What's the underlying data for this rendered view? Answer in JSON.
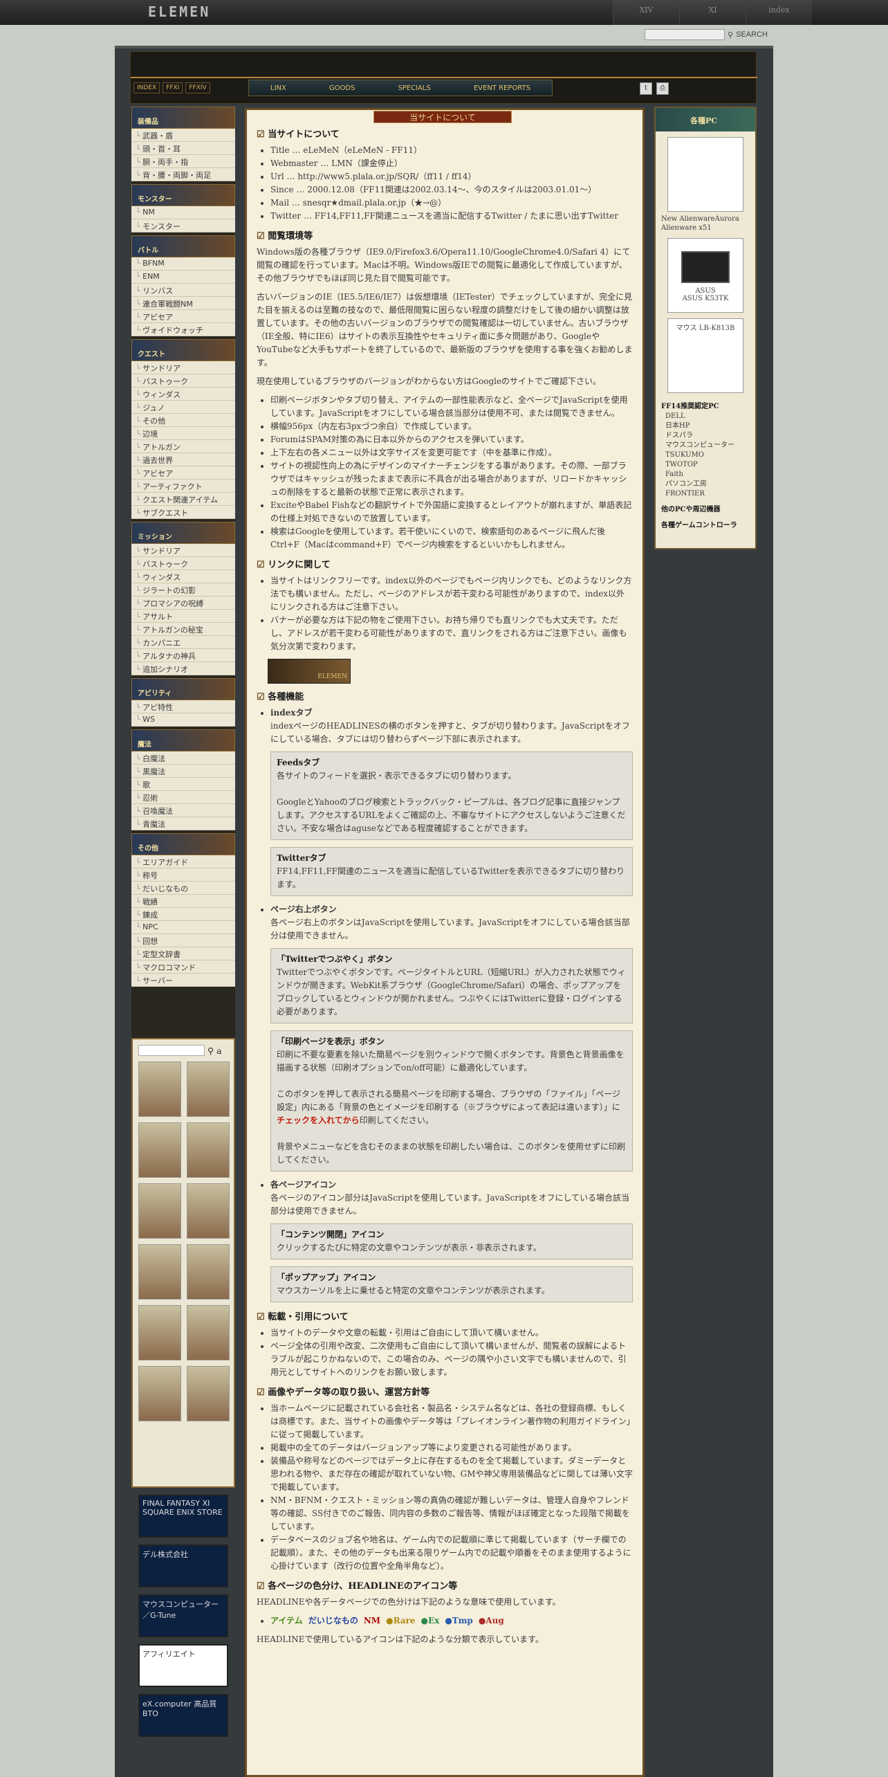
{
  "top": {
    "logo": "ELEMEN",
    "nav": [
      "XIV",
      "XI",
      "index"
    ],
    "search_label": "SEARCH"
  },
  "header": {
    "tabs": [
      "INDEX",
      "FFXI",
      "FFXIV"
    ],
    "nav": [
      "LINX",
      "GOODS",
      "SPECIALS",
      "EVENT REPORTS"
    ]
  },
  "main_title": "当サイトについて",
  "sidebar": [
    {
      "title": "装備品",
      "items": [
        "武器・盾",
        "頭・首・耳",
        "胴・両手・指",
        "背・腰・両脚・両足"
      ]
    },
    {
      "title": "モンスター",
      "items": [
        "NM",
        "モンスター"
      ]
    },
    {
      "title": "バトル",
      "items": [
        "BFNM",
        "ENM",
        "リンバス",
        "連合軍戦闘NM",
        "アビセア",
        "ヴォイドウォッチ"
      ]
    },
    {
      "title": "クエスト",
      "items": [
        "サンドリア",
        "バストゥーク",
        "ウィンダス",
        "ジュノ",
        "その他",
        "辺境",
        "アトルガン",
        "過去世界",
        "アビセア",
        "アーティファクト",
        "クエスト関連アイテム",
        "サブクエスト"
      ]
    },
    {
      "title": "ミッション",
      "items": [
        "サンドリア",
        "バストゥーク",
        "ウィンダス",
        "ジラートの幻影",
        "プロマシアの呪縛",
        "アサルト",
        "アトルガンの秘宝",
        "カンパニエ",
        "アルタナの神兵",
        "追加シナリオ"
      ]
    },
    {
      "title": "アビリティ",
      "items": [
        "アビ特性",
        "WS"
      ]
    },
    {
      "title": "魔法",
      "items": [
        "白魔法",
        "黒魔法",
        "歌",
        "忍術",
        "召喚魔法",
        "青魔法"
      ]
    },
    {
      "title": "その他",
      "items": [
        "エリアガイド",
        "称号",
        "だいじなもの",
        "戦績",
        "錬成",
        "NPC",
        "回想",
        "定型文辞書",
        "マクロコマンド",
        "サーバー"
      ]
    }
  ],
  "banners": [
    "FINAL FANTASY XI SQUARE ENIX STORE",
    "デル株式会社",
    "マウスコンピューター／G-Tune",
    "アフィリエイト",
    "eX.computer 高品質BTO"
  ],
  "right": {
    "title": "各種PC",
    "pcs": [
      {
        "img": "",
        "cap": "New AlienwareAurora Alienware x51"
      },
      {
        "img": "ASUS",
        "cap": "ASUS K53TK"
      },
      {
        "img": "マウス LB-K813B",
        "cap": ""
      }
    ],
    "rec_title": "FF14推奨認定PC",
    "rec": [
      "DELL",
      "日本HP",
      "ドスパラ",
      "マウスコンピューター",
      "TSUKUMO",
      "TWOTOP",
      "Faith",
      "パソコン工房",
      "FRONTIER"
    ],
    "other": [
      "他のPCや周辺機器",
      "各種ゲームコントローラ"
    ]
  },
  "s1": {
    "h": "当サイトについて",
    "items": [
      "Title … eLeMeN（eLeMeN - FF11）",
      "Webmaster … LMN（課金停止）",
      "Url … http://www5.plala.or.jp/SQR/（ff11 / ff14）",
      "Since … 2000.12.08（FF11関連は2002.03.14～、今のスタイルは2003.01.01～）",
      "Mail … snesqr★dmail.plala.or.jp（★→@）",
      "Twitter … FF14,FF11,FF関連ニュースを適当に配信するTwitter / たまに思い出すTwitter"
    ]
  },
  "s2": {
    "h": "閲覧環境等",
    "p1": "Windows版の各種ブラウザ（IE9.0/Firefox3.6/Opera11.10/GoogleChrome4.0/Safari 4）にて閲覧の確認を行っています。Macは不明。Windows版IEでの閲覧に最適化して作成していますが、その他ブラウザでもほぼ同じ見た目で閲覧可能です。",
    "p2": "古いバージョンのIE（IE5.5/IE6/IE7）は仮想環境（IETester）でチェックしていますが、完全に見た目を揃えるのは至難の技なので、最低限閲覧に困らない程度の調整だけをして後の細かい調整は放置しています。その他の古いバージョンのブラウザでの閲覧確認は一切していません。古いブラウザ（IE全般、特にIE6）はサイトの表示互換性やセキュリティ面に多々問題があり、GoogleやYouTubeなど大手もサポートを終了しているので、最新版のブラウザを使用する事を強くお勧めします。",
    "p3": "現在使用しているブラウザのバージョンがわからない方はGoogleのサイトでご確認下さい。",
    "items": [
      "印刷ページボタンやタブ切り替え、アイテムの一部性能表示など、全ページでJavaScriptを使用しています。JavaScriptをオフにしている場合該当部分は使用不可、または閲覧できません。",
      "横幅956px（内左右3pxづつ余白）で作成しています。",
      "ForumはSPAM対策の為に日本以外からのアクセスを弾いています。",
      "上下左右の各メニュー以外は文字サイズを変更可能です（中を基準に作成）。",
      "サイトの視認性向上の為にデザインのマイナーチェンジをする事があります。その際、一部ブラウザではキャッシュが残ったままで表示に不具合が出る場合がありますが、リロードかキャッシュの削除をすると最新の状態で正常に表示されます。",
      "ExciteやBabel Fishなどの翻訳サイトで外国語に変換するとレイアウトが崩れますが、単語表記の仕様上対処できないので放置しています。",
      "検索はGoogleを使用しています。若干使いにくいので、検索語句のあるページに飛んだ後Ctrl+F（Macはcommand+F）でページ内検索をするといいかもしれません。"
    ]
  },
  "s3": {
    "h": "リンクに関して",
    "items": [
      "当サイトはリンクフリーです。index以外のページでもページ内リンクでも、どのようなリンク方法でも構いません。ただし、ページのアドレスが若干変わる可能性がありますので、index以外にリンクされる方はご注意下さい。",
      "バナーが必要な方は下記の物をご使用下さい。お持ち帰りでも直リンクでも大丈夫です。ただし、アドレスが若干変わる可能性がありますので、直リンクをされる方はご注意下さい。画像も気分次第で変わります。"
    ]
  },
  "s4": {
    "h": "各種機能",
    "index_tab": "indexタブ",
    "index_desc": "indexページのHEADLINESの横のボタンを押すと、タブが切り替わります。JavaScriptをオフにしている場合、タブには切り替わらずページ下部に表示されます。",
    "feeds_h": "Feedsタブ",
    "feeds_p": "各サイトのフィードを選択・表示できるタブに切り替わります。",
    "feeds_p2": "GoogleとYahooのブログ検索とトラックバック・ピープルは、各ブログ記事に直接ジャンプします。アクセスするURLをよくご確認の上、不審なサイトにアクセスしないようご注意ください。不安な場合はaguseなどである程度確認することができます。",
    "tw_h": "Twitterタブ",
    "tw_p": "FF14,FF11,FF関連のニュースを適当に配信しているTwitterを表示できるタブに切り替わります。",
    "topright": "ページ右上ボタン",
    "topright_p": "各ページ右上のボタンはJavaScriptを使用しています。JavaScriptをオフにしている場合該当部分は使用できません。",
    "tweet_h": "「Twitterでつぶやく」ボタン",
    "tweet_p": "Twitterでつぶやくボタンです。ページタイトルとURL（短縮URL）が入力された状態でウィンドウが開きます。WebKit系ブラウザ（GoogleChrome/Safari）の場合、ポップアップをブロックしているとウィンドウが開かれません。つぶやくにはTwitterに登録・ログインする必要があります。",
    "print_h": "「印刷ページを表示」ボタン",
    "print_p": "印刷に不要な要素を除いた簡易ページを別ウィンドウで開くボタンです。背景色と背景画像を描画する状態（印刷オプションでon/off可能）に最適化しています。",
    "print_p2a": "このボタンを押して表示される簡易ページを印刷する場合、ブラウザの「ファイル」「ページ設定」内にある「背景の色とイメージを印刷する（※ブラウザによって表記は違います）」に",
    "print_red": "チェックを入れてから",
    "print_p2b": "印刷してください。",
    "print_p3": "背景やメニューなどを含むそのままの状態を印刷したい場合は、このボタンを使用せずに印刷してください。",
    "icon_h": "各ページアイコン",
    "icon_p": "各ページのアイコン部分はJavaScriptを使用しています。JavaScriptをオフにしている場合該当部分は使用できません。",
    "open_h": "「コンテンツ開閉」アイコン",
    "open_p": "クリックするたびに特定の文章やコンテンツが表示・非表示されます。",
    "pop_h": "「ポップアップ」アイコン",
    "pop_p": "マウスカーソルを上に乗せると特定の文章やコンテンツが表示されます。"
  },
  "s5": {
    "h": "転載・引用について",
    "items": [
      "当サイトのデータや文章の転載・引用はご自由にして頂いて構いません。",
      "ページ全体の引用や改変、二次使用もご自由にして頂いて構いませんが、閲覧者の誤解によるトラブルが起こりかねないので、この場合のみ、ページの隅や小さい文字でも構いませんので、引用元としてサイトへのリンクをお願い致します。"
    ]
  },
  "s6": {
    "h": "画像やデータ等の取り扱い、運営方針等",
    "items": [
      "当ホームページに記載されている会社名・製品名・システム名などは、各社の登録商標、もしくは商標です。また、当サイトの画像やデータ等は「プレイオンライン著作物の利用ガイドライン」に従って掲載しています。",
      "掲載中の全てのデータはバージョンアップ等により変更される可能性があります。",
      "装備品や称号などのページではデータ上に存在するものを全て掲載しています。ダミーデータと思われる物や、まだ存在の確認が取れていない物、GMや神父専用装備品などに関しては薄い文字で掲載しています。",
      "NM・BFNM・クエスト・ミッション等の真偽の確認が難しいデータは、管理人自身やフレンド等の確認、SS付きでのご報告、同内容の多数のご報告等、情報がほぼ確定となった段階で掲載をしています。",
      "データベースのジョブ名や地名は、ゲーム内での記載順に準じて掲載しています（サーチ欄での記載順）。また、その他のデータも出来る限りゲーム内での記載や順番をそのまま使用するように心掛けています（改行の位置や全角半角など）。"
    ]
  },
  "s7": {
    "h": "各ページの色分け、HEADLINEのアイコン等",
    "p": "HEADLINEや各データページでの色分けは下記のような意味で使用しています。",
    "colors": [
      {
        "t": "アイテム",
        "c": "#4a8a20"
      },
      {
        "t": "だいじなもの",
        "c": "#2a48a0"
      },
      {
        "t": "NM",
        "c": "#b01010"
      },
      {
        "t": "●Rare",
        "c": "#b08a10"
      },
      {
        "t": "●Ex",
        "c": "#2a8a4a"
      },
      {
        "t": "●Tmp",
        "c": "#2a5ab0"
      },
      {
        "t": "●Aug",
        "c": "#b02a2a"
      }
    ],
    "p2": "HEADLINEで使用しているアイコンは下記のような分類で表示しています。"
  }
}
